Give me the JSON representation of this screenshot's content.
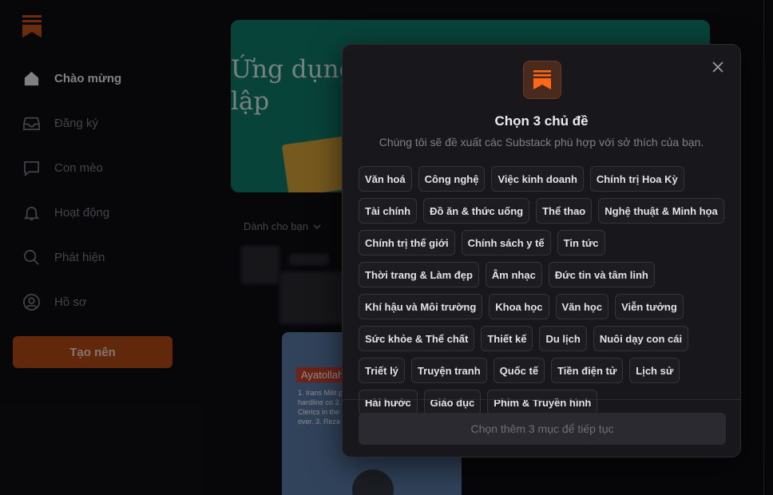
{
  "sidebar": {
    "items": [
      {
        "label": "Chào mừng",
        "icon": "home-icon"
      },
      {
        "label": "Đăng ký",
        "icon": "inbox-icon"
      },
      {
        "label": "Con mèo",
        "icon": "chat-icon"
      },
      {
        "label": "Hoạt động",
        "icon": "bell-icon"
      },
      {
        "label": "Phát hiện",
        "icon": "search-icon"
      },
      {
        "label": "Hồ sơ",
        "icon": "profile-icon"
      }
    ],
    "create_label": "Tạo nên"
  },
  "feed": {
    "banner_title": "Ứng dụng lập",
    "filter_label": "Dành cho bạn",
    "post_tag": "Ayatollah",
    "post_lines": "1. Irans Milit power sidel putting in p hardline co 2. Mojtaba Ayatollahs s Clerics in the line of succession take over. 3. Reza Panlav"
  },
  "modal": {
    "title": "Chọn 3 chủ đề",
    "subtitle": "Chúng tôi sẽ đề xuất các Substack phù hợp với sở thích của bạn.",
    "topics": [
      "Văn hoá",
      "Công nghệ",
      "Việc kinh doanh",
      "Chính trị Hoa Kỳ",
      "Tài chính",
      "Đồ ăn & thức uống",
      "Thể thao",
      "Nghệ thuật & Minh họa",
      "Chính trị thế giới",
      "Chính sách y tế",
      "Tin tức",
      "Thời trang & Làm đẹp",
      "Âm nhạc",
      "Đức tin và tâm linh",
      "Khí hậu và Môi trường",
      "Khoa học",
      "Văn học",
      "Viễn tưởng",
      "Sức khỏe & Thể chất",
      "Thiết kế",
      "Du lịch",
      "Nuôi dạy con cái",
      "Triết lý",
      "Truyện tranh",
      "Quốc tế",
      "Tiền điện tử",
      "Lịch sử",
      "Hài hước",
      "Giáo dục",
      "Phim & Truyền hình"
    ],
    "continue_label": "Chọn thêm 3 mục để tiếp tục"
  },
  "colors": {
    "accent": "#ff6719",
    "background": "#0e0e12",
    "modal_bg": "#17171c"
  }
}
